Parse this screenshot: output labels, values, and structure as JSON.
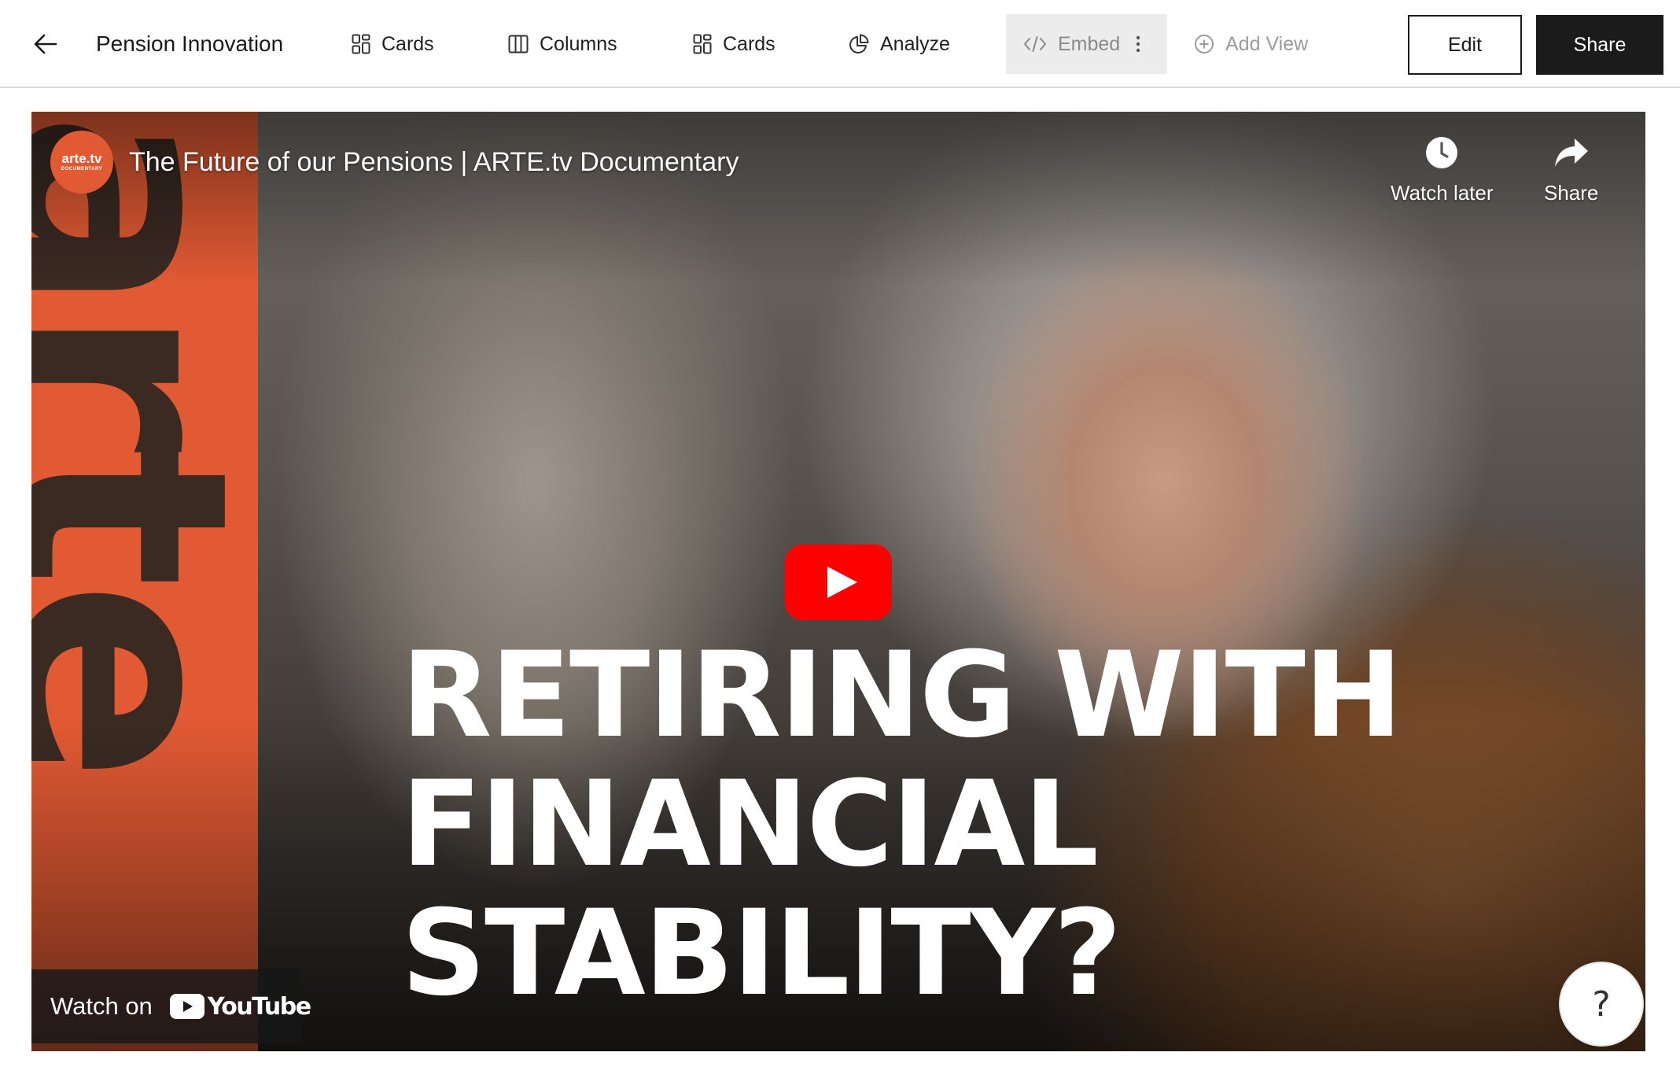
{
  "header": {
    "title": "Pension Innovation",
    "tabs": [
      {
        "label": "Cards",
        "icon": "cards-icon"
      },
      {
        "label": "Columns",
        "icon": "columns-icon"
      },
      {
        "label": "Cards",
        "icon": "cards-icon"
      },
      {
        "label": "Analyze",
        "icon": "pie-chart-icon"
      },
      {
        "label": "Embed",
        "icon": "code-icon",
        "active": true
      },
      {
        "label": "Add View",
        "icon": "plus-circle-icon"
      }
    ],
    "edit_label": "Edit",
    "share_label": "Share"
  },
  "video": {
    "channel_logo_text": "arte.tv",
    "channel_logo_sub": "DOCUMENTARY",
    "title": "The Future of our Pensions | ARTE.tv Documentary",
    "watch_later_label": "Watch later",
    "share_label": "Share",
    "overlay_lines": [
      "RETIRING WITH",
      "FINANCIAL",
      "STABILITY?"
    ],
    "background_word": "arte",
    "watch_on_label": "Watch on",
    "youtube_wordmark": "YouTube"
  },
  "help": {
    "label": "?"
  },
  "colors": {
    "accent_dark": "#1b1b1b",
    "arte_orange": "#e25a33",
    "youtube_red": "#ff0000",
    "embed_tab_bg": "#ececec"
  }
}
